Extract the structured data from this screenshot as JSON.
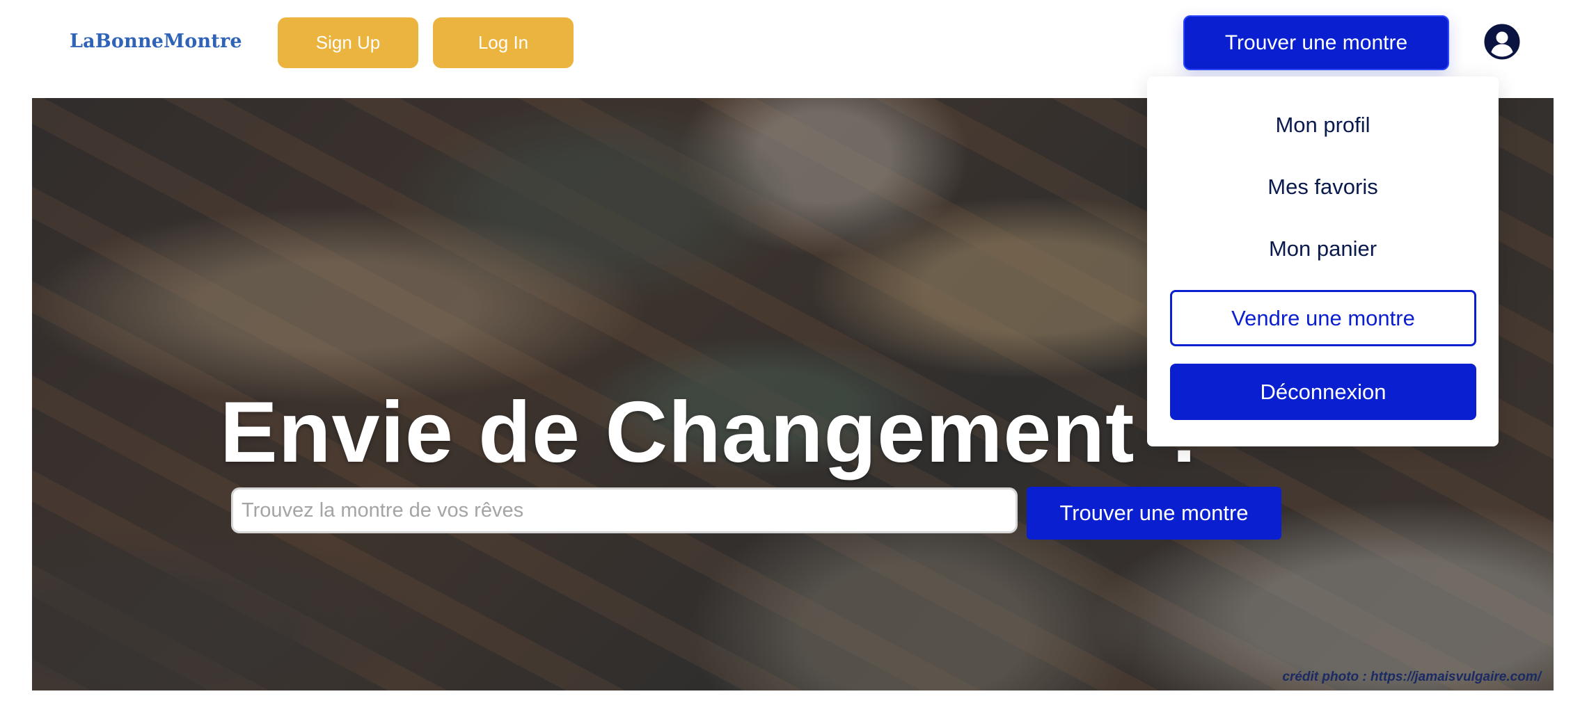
{
  "brand": {
    "logo_text": "LaBonneMontre"
  },
  "header": {
    "signup_label": "Sign Up",
    "login_label": "Log In",
    "find_watch_label": "Trouver une montre",
    "avatar_icon": "user-circle-icon"
  },
  "dropdown": {
    "items": [
      {
        "label": "Mon profil"
      },
      {
        "label": "Mes favoris"
      },
      {
        "label": "Mon panier"
      }
    ],
    "sell_label": "Vendre une montre",
    "logout_label": "Déconnexion"
  },
  "hero": {
    "title": "Envie de Changement ?",
    "search_placeholder": "Trouvez la montre de vos rêves",
    "search_value": "",
    "find_watch_label": "Trouver une montre",
    "photo_credit": "crédit photo : https://jamaisvulgaire.com/"
  },
  "colors": {
    "brand_blue": "#0a1fcf",
    "logo_blue": "#2f63b8",
    "accent_yellow": "#ebb43f",
    "menu_text": "#0b1a4d"
  }
}
